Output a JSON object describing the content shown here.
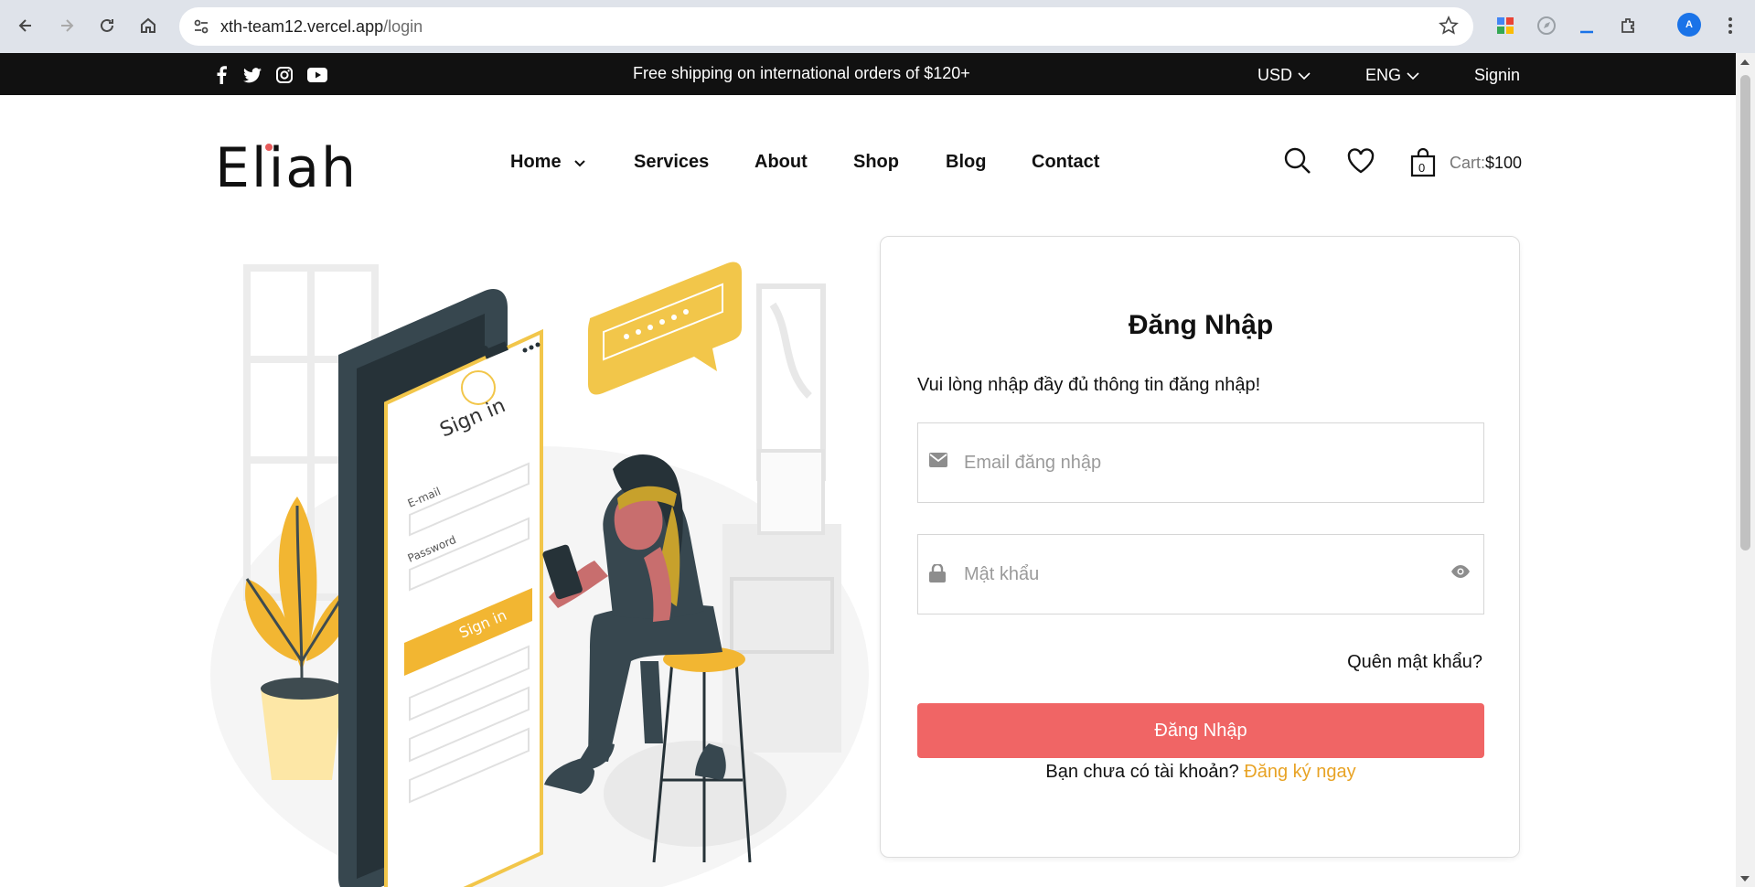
{
  "browser": {
    "url_host": "xth-team12.vercel.app",
    "url_path": "/login"
  },
  "topbar": {
    "promo": "Free shipping on international orders of $120+",
    "currency": "USD",
    "language": "ENG",
    "signin": "Signin"
  },
  "header": {
    "logo": "Eliah",
    "menu": [
      "Home",
      "Services",
      "About",
      "Shop",
      "Blog",
      "Contact"
    ],
    "cart_count": "0",
    "cart_prefix": "Cart:",
    "cart_total": "$100"
  },
  "illustration": {
    "title": "Sign in",
    "email_label": "E-mail",
    "password_label": "Password",
    "button": "Sign in"
  },
  "login": {
    "title": "Đăng Nhập",
    "subtitle": "Vui lòng nhập đầy đủ thông tin đăng nhập!",
    "email_placeholder": "Email đăng nhập",
    "email_value": "",
    "password_placeholder": "Mật khẩu",
    "password_value": "",
    "forgot": "Quên mật khẩu?",
    "submit": "Đăng Nhập",
    "no_account": "Bạn chưa có tài khoản?",
    "signup_link": "Đăng ký ngay"
  },
  "colors": {
    "accent": "#f06565",
    "link": "#e8a325",
    "topbar": "#111111"
  }
}
